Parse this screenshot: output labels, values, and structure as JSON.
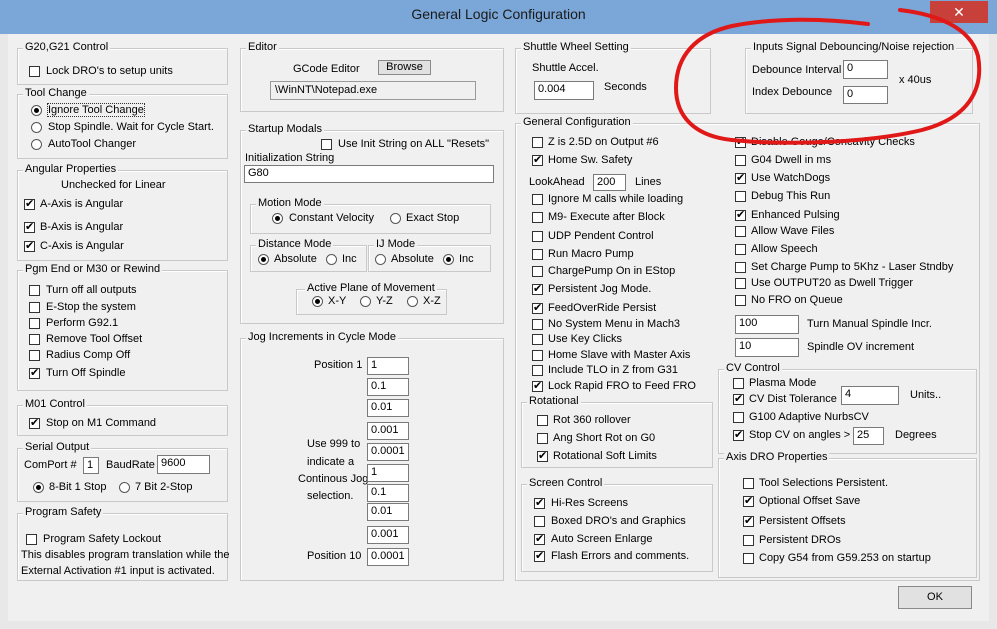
{
  "window": {
    "title": "General Logic Configuration",
    "close_label": "✕"
  },
  "colors": {
    "title_bar": "#7aa6d8",
    "annotation_red": "#e01818",
    "dialog_bg": "#f0f0f0"
  },
  "g20": {
    "title": "G20,G21 Control",
    "lock_dros": "Lock DRO's to setup units"
  },
  "tool_change": {
    "title": "Tool Change",
    "ignore": "Ignore Tool Change",
    "stop": "Stop Spindle. Wait for Cycle Start.",
    "auto": "AutoTool Changer"
  },
  "angular": {
    "title": "Angular Properties",
    "note": "Unchecked for Linear",
    "a": "A-Axis is Angular",
    "b": "B-Axis is Angular",
    "c": "C-Axis is Angular"
  },
  "pgm_end": {
    "title": "Pgm End or M30 or Rewind",
    "items": [
      "Turn off all outputs",
      "E-Stop the system",
      "Perform G92.1",
      "Remove Tool Offset",
      "Radius Comp Off",
      "Turn Off Spindle"
    ]
  },
  "m01": {
    "title": "M01 Control",
    "stop_m1": "Stop on M1 Command"
  },
  "serial": {
    "title": "Serial Output",
    "comport_label": "ComPort #",
    "comport_value": "1",
    "baud_label": "BaudRate",
    "baud_value": "9600",
    "bit8": "8-Bit 1 Stop",
    "bit7": "7 Bit 2-Stop"
  },
  "safety": {
    "title": "Program Safety",
    "lockout": "Program Safety Lockout",
    "note1": "This disables program translation while the",
    "note2": "External Activation #1 input is activated."
  },
  "editor": {
    "title": "Editor",
    "label": "GCode Editor",
    "browse": "Browse",
    "path": "\\WinNT\\Notepad.exe"
  },
  "startup": {
    "title": "Startup Modals",
    "use_init": "Use Init String on ALL  \"Resets\"",
    "init_label": "Initialization String",
    "init_value": "G80",
    "motion_title": "Motion Mode",
    "constant": "Constant Velocity",
    "exact": "Exact Stop",
    "distance_title": "Distance Mode",
    "ij_title": "IJ Mode",
    "absolute": "Absolute",
    "inc": "Inc",
    "plane_title": "Active Plane of Movement",
    "xy": "X-Y",
    "yz": "Y-Z",
    "xz": "X-Z"
  },
  "jog": {
    "title": "Jog Increments in Cycle Mode",
    "pos1": "Position 1",
    "pos10": "Position 10",
    "note": [
      "Use 999 to",
      "indicate a",
      "Continous Jog",
      "selection."
    ],
    "values": [
      "1",
      "0.1",
      "0.01",
      "0.001",
      "0.0001",
      "1",
      "0.1",
      "0.01",
      "0.001",
      "0.0001"
    ]
  },
  "shuttle": {
    "title": "Shuttle Wheel Setting",
    "accel_label": "Shuttle Accel.",
    "accel_value": "0.004",
    "seconds": "Seconds"
  },
  "debounce": {
    "title": "Inputs Signal Debouncing/Noise rejection",
    "interval_label": "Debounce Interval",
    "interval_value": "0",
    "index_label": "Index Debounce",
    "index_value": "0",
    "unit": "x 40us"
  },
  "general": {
    "title": "General Configuration",
    "left": [
      "Z is 2.5D on Output #6",
      "Home Sw. Safety"
    ],
    "lookahead_label": "LookAhead",
    "lookahead_value": "200",
    "lines": "Lines",
    "left2": [
      "Ignore M calls while loading",
      "M9- Execute after Block",
      "UDP Pendent Control",
      "Run Macro Pump",
      "ChargePump On in EStop",
      "Persistent Jog Mode.",
      "FeedOverRide Persist",
      "No System Menu in Mach3",
      "Use Key Clicks",
      "Home Slave with Master Axis",
      "Include TLO in Z from G31",
      "Lock Rapid FRO to Feed FRO"
    ],
    "right": [
      "Disable Gouge/Concavity Checks",
      "G04 Dwell in ms",
      "Use WatchDogs",
      "Debug This Run",
      "Enhanced Pulsing",
      "Allow Wave Files",
      "Allow Speech",
      "Set Charge Pump to 5Khz  - Laser Stndby",
      "Use OUTPUT20 as Dwell Trigger",
      "No FRO on Queue"
    ],
    "turn_value": "100",
    "turn_label": "Turn Manual Spindle Incr.",
    "ov_value": "10",
    "ov_label": "Spindle OV increment"
  },
  "rotational": {
    "title": "Rotational",
    "items": [
      "Rot 360 rollover",
      "Ang Short Rot on G0",
      "Rotational Soft Limits"
    ]
  },
  "screen": {
    "title": "Screen Control",
    "items": [
      "Hi-Res Screens",
      "Boxed DRO's and Graphics",
      "Auto Screen Enlarge",
      "Flash Errors and comments."
    ]
  },
  "cv": {
    "title": "CV Control",
    "plasma": "Plasma Mode",
    "cv_dist": "CV Dist Tolerance",
    "cv_value": "4",
    "units": "Units..",
    "g100": "G100 Adaptive NurbsCV",
    "stop_cv": "Stop CV on angles >",
    "angle_value": "25",
    "degrees": "Degrees"
  },
  "axis_dro": {
    "title": "Axis DRO Properties",
    "items": [
      "Tool Selections Persistent.",
      "Optional Offset Save",
      "Persistent Offsets",
      "Persistent DROs",
      "Copy G54 from G59.253 on startup"
    ]
  },
  "ok_label": "OK"
}
